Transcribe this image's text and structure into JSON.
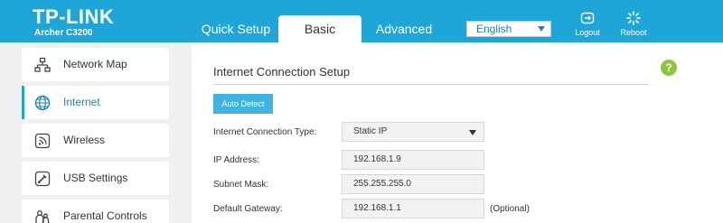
{
  "brand": {
    "logo": "TP-LINK",
    "model": "Archer C3200"
  },
  "tabs": [
    {
      "label": "Quick Setup"
    },
    {
      "label": "Basic"
    },
    {
      "label": "Advanced"
    }
  ],
  "language": {
    "selected": "English"
  },
  "header_buttons": {
    "logout": "Logout",
    "reboot": "Reboot"
  },
  "sidebar": {
    "items": [
      {
        "label": "Network Map",
        "icon": "network-map-icon"
      },
      {
        "label": "Internet",
        "icon": "globe-icon",
        "active": true
      },
      {
        "label": "Wireless",
        "icon": "wireless-icon"
      },
      {
        "label": "USB Settings",
        "icon": "usb-icon"
      },
      {
        "label": "Parental Controls",
        "icon": "parental-icon"
      }
    ]
  },
  "main": {
    "title": "Internet Connection Setup",
    "auto_detect": "Auto Detect",
    "fields": [
      {
        "label": "Internet Connection Type:",
        "value": "Static IP"
      },
      {
        "label": "IP Address:",
        "value": "192.168.1.9"
      },
      {
        "label": "Subnet Mask:",
        "value": "255.255.255.0"
      },
      {
        "label": "Default Gateway:",
        "value": "192.168.1.1",
        "note": "(Optional)"
      }
    ],
    "help": "?"
  },
  "colors": {
    "header": "#1ea6d9",
    "accent": "#1e83b8",
    "help": "#8dc540",
    "button": "#3fb4e0"
  }
}
